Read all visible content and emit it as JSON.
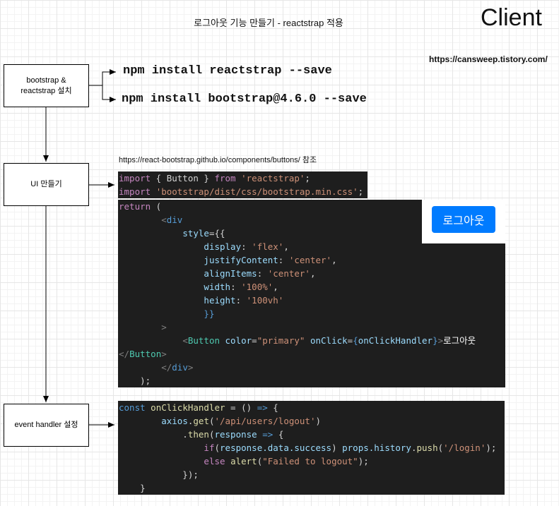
{
  "header": {
    "title": "로그아웃 기능 만들기 - reactstrap 적용",
    "client_label": "Client",
    "blog_url": "https://cansweep.tistory.com/"
  },
  "steps": [
    {
      "label_line1": "bootstrap &",
      "label_line2": "reactstrap 설치"
    },
    {
      "label": "UI 만들기"
    },
    {
      "label": "event handler 설정"
    }
  ],
  "commands": [
    "npm install reactstrap --save",
    "npm install bootstrap@4.6.0 --save"
  ],
  "reference": "https://react-bootstrap.github.io/components/buttons/ 참조",
  "code": {
    "import1": {
      "kw": "import",
      "text": " { Button } ",
      "from": "from",
      "str": "'reactstrap'",
      "end": ";"
    },
    "import2": {
      "kw": "import",
      "str": "'bootstrap/dist/css/bootstrap.min.css'",
      "end": ";"
    },
    "return_kw": "return",
    "div": "div",
    "style_attr": "style",
    "styles": [
      {
        "key": "display",
        "value": "'flex'"
      },
      {
        "key": "justifyContent",
        "value": "'center'"
      },
      {
        "key": "alignItems",
        "value": "'center'"
      },
      {
        "key": "width",
        "value": "'100%'"
      },
      {
        "key": "height",
        "value": "'100vh'"
      }
    ],
    "button_tag": "Button",
    "color_attr": "color",
    "color_value": "\"primary\"",
    "onclick_attr": "onClick",
    "handler_name": "onClickHandler",
    "button_text": "로그아웃",
    "handler": {
      "const_kw": "const",
      "name": "onClickHandler",
      "axios": "axios",
      "get": "get",
      "url": "'/api/users/logout'",
      "then": "then",
      "response": "response",
      "cond_path": "response.data.success",
      "if_kw": "if",
      "props_path": "props.history",
      "push": "push",
      "push_url": "'/login'",
      "else_kw": "else",
      "alert": "alert",
      "alert_msg": "\"Failed to logout\""
    }
  },
  "preview_button": "로그아웃",
  "colors": {
    "code_bg": "#1e1e1e",
    "button_primary": "#007bff"
  }
}
